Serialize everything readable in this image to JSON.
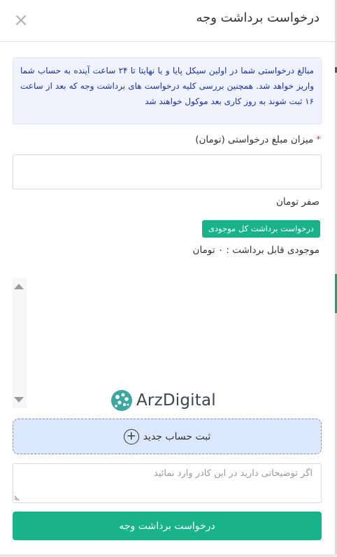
{
  "modal": {
    "title": "درخواست برداشت وجه",
    "close_symbol": "×",
    "info_text": "مبالغ درخواستی شما در اولین سیکل پایا و یا نهایتا تا ۲۴ ساعت آینده به حساب شما واریز خواهد شد. همچنین بررسی کلیه درخواست های برداشت وجه که بعد از ساعت ۱۶ ثبت شوند به روز کاری بعد موکول خواهند شد",
    "amount_label": "میزان مبلغ درخواستی (تومان)",
    "required_mark": "*",
    "amount_value": "",
    "amount_in_words": "صفر تومان",
    "withdraw_all_button": "درخواست برداشت کل موجودی",
    "balance_text": "موجودی قابل برداشت : ۰ تومان",
    "new_account_button": "ثبت حساب جدید",
    "new_account_icon": "plus-circle-icon",
    "description_placeholder": "اگر توضیحاتی دارید در این کادر وارد نمائید",
    "description_value": "",
    "submit_button": "درخواست برداشت وجه"
  },
  "watermark": {
    "text": "ArzDigital"
  },
  "colors": {
    "accent": "#18b38b",
    "info_bg": "#eef3fd",
    "info_text": "#1e2fb3",
    "new_account_bg": "#dbe8fb",
    "required": "#e04040"
  }
}
